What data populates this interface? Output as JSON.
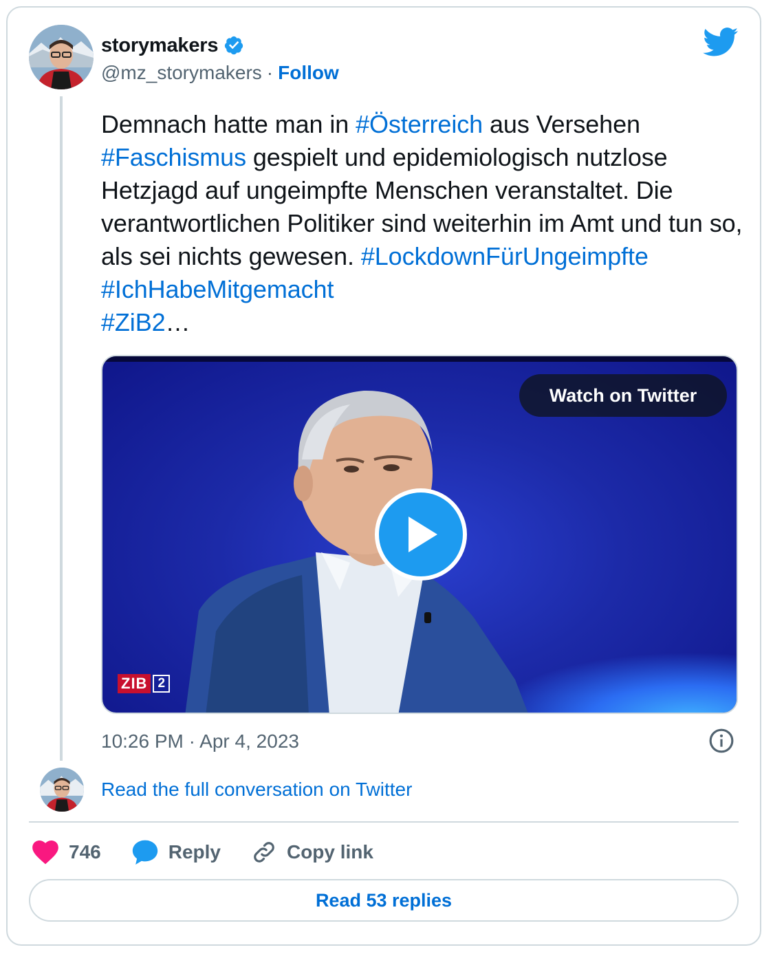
{
  "author": {
    "display_name": "storymakers",
    "handle": "@mz_storymakers",
    "separator": "·",
    "follow_label": "Follow",
    "verified": true
  },
  "tweet": {
    "segments": [
      {
        "text": "Demnach hatte man in ",
        "tag": false
      },
      {
        "text": "#Österreich",
        "tag": true
      },
      {
        "text": " aus Versehen ",
        "tag": false
      },
      {
        "text": "#Faschismus",
        "tag": true
      },
      {
        "text": " gespielt und epidemiologisch nutzlose Hetzjagd auf ungeimpfte Menschen veranstaltet. Die verantwortlichen Politiker sind weiterhin im Amt und tun so, als sei nichts gewesen. ",
        "tag": false
      },
      {
        "text": "#LockdownFürUngeimpfte",
        "tag": true
      },
      {
        "text": " ",
        "tag": false
      },
      {
        "text": "#IchHabeMitgemacht",
        "tag": true
      },
      {
        "text": " ",
        "tag": false
      },
      {
        "text": "#ZiB2",
        "tag": true
      },
      {
        "text": "…",
        "tag": false
      }
    ]
  },
  "media": {
    "watch_label": "Watch on Twitter",
    "broadcast_logo": {
      "text": "ZIB",
      "number": "2"
    }
  },
  "meta": {
    "timestamp": "10:26 PM · Apr 4, 2023",
    "conversation_link": "Read the full conversation on Twitter"
  },
  "actions": {
    "like_count": "746",
    "reply_label": "Reply",
    "copy_label": "Copy link"
  },
  "replies_button": "Read 53 replies",
  "colors": {
    "link": "#006fd6",
    "twitter_blue": "#1d9bf0",
    "like_pink": "#f91880",
    "secondary_text": "#536471",
    "border": "#cfd9de"
  },
  "icons": [
    "twitter-bird-icon",
    "verified-badge-icon",
    "play-icon",
    "info-icon",
    "heart-icon",
    "reply-bubble-icon",
    "link-icon"
  ]
}
